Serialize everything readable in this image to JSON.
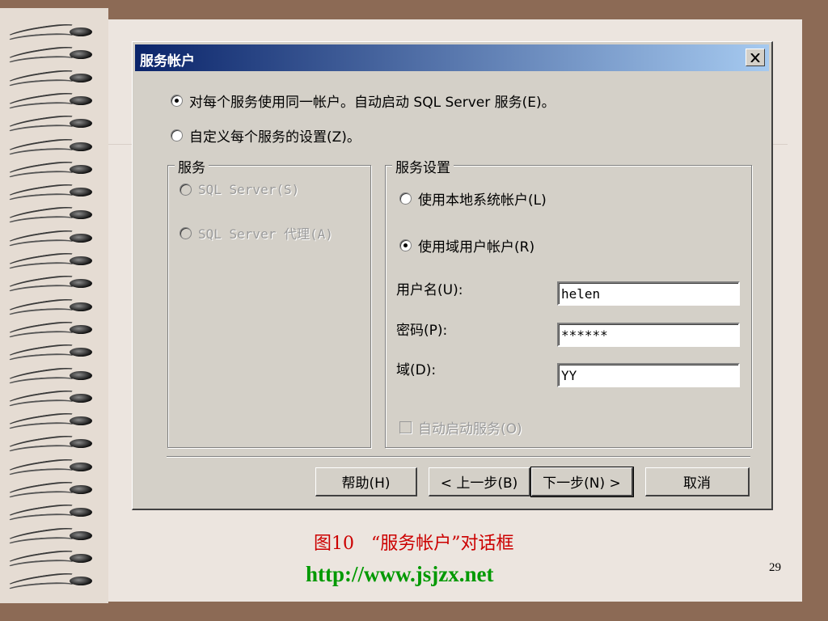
{
  "dialog": {
    "title": "服务帐户",
    "close_label": "×",
    "option_same": {
      "text": "对每个服务使用同一帐户。自动启动 SQL Server 服务(E)。",
      "checked": true
    },
    "option_custom": {
      "text": "自定义每个服务的设置(Z)。",
      "checked": false
    },
    "services_group": {
      "label": "服务",
      "items": [
        "SQL Server(S)",
        "SQL Server 代理(A)"
      ]
    },
    "settings_group": {
      "label": "服务设置",
      "local_account": "使用本地系统帐户(L)",
      "domain_account": "使用域用户帐户(R)",
      "username_label": "用户名(U):",
      "username_value": "helen",
      "password_label": "密码(P):",
      "password_value": "******",
      "domain_label": "域(D):",
      "domain_value": "YY",
      "autostart_label": "自动启动服务(O)"
    },
    "buttons": {
      "help": "帮助(H)",
      "back": "< 上一步(B)",
      "next": "下一步(N) >",
      "cancel": "取消"
    }
  },
  "slide": {
    "caption": "图10   “服务帐户”对话框",
    "url": "http://www.jsjzx.net",
    "page_number": "29"
  }
}
